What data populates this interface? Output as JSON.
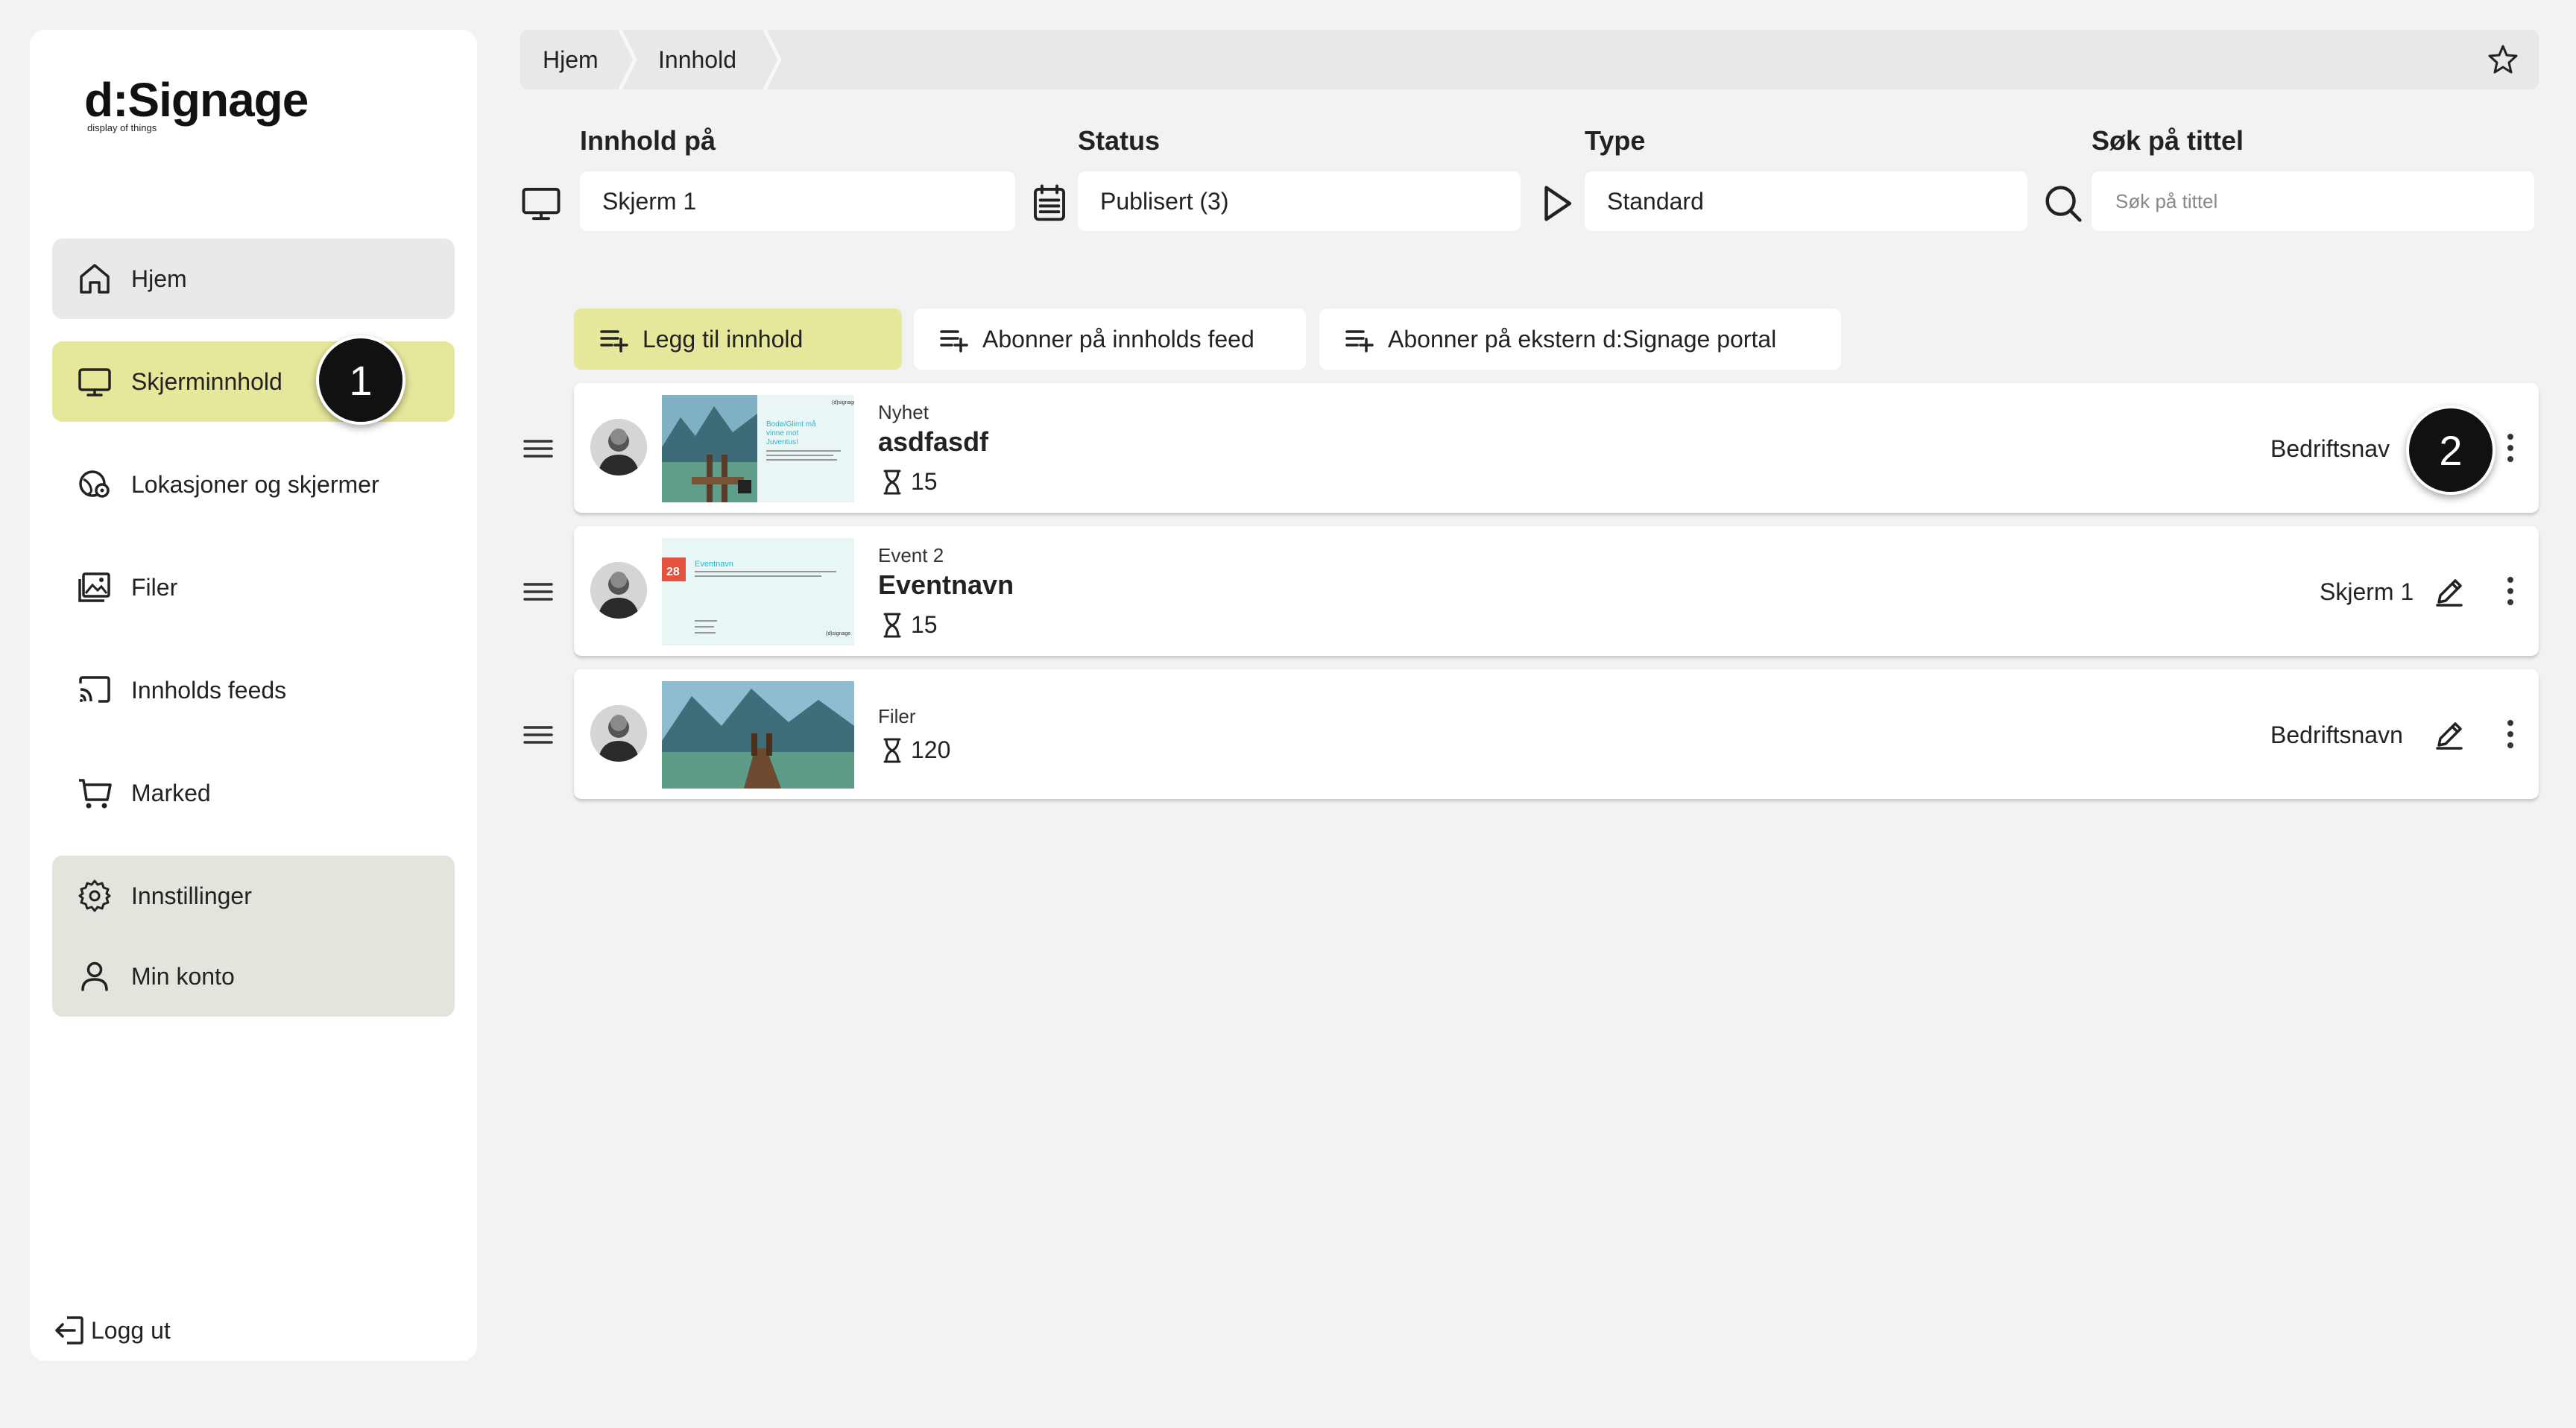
{
  "brand": {
    "name": "d:Signage",
    "tagline": "display of things"
  },
  "sidebar": {
    "items": [
      {
        "label": "Hjem",
        "icon": "home-icon"
      },
      {
        "label": "Skjerminnhold",
        "icon": "monitor-icon"
      },
      {
        "label": "Lokasjoner og skjermer",
        "icon": "location-icon"
      },
      {
        "label": "Filer",
        "icon": "image-icon"
      },
      {
        "label": "Innholds feeds",
        "icon": "cast-icon"
      },
      {
        "label": "Marked",
        "icon": "cart-icon"
      }
    ],
    "settings": [
      {
        "label": "Innstillinger",
        "icon": "gear-icon"
      },
      {
        "label": "Min konto",
        "icon": "user-icon"
      }
    ],
    "logout_label": "Logg ut",
    "active_color": "#e5e79b"
  },
  "breadcrumb": [
    "Hjem",
    "Innhold"
  ],
  "filters": {
    "content_on": {
      "label": "Innhold på",
      "value": "Skjerm 1"
    },
    "status": {
      "label": "Status",
      "value": "Publisert (3)"
    },
    "type": {
      "label": "Type",
      "value": "Standard"
    },
    "search": {
      "label": "Søk på tittel",
      "placeholder": "Søk på tittel",
      "value": ""
    }
  },
  "actions": {
    "add": "Legg til innhold",
    "subscribe_feed": "Abonner på innholds feed",
    "subscribe_portal": "Abonner på ekstern d:Signage portal"
  },
  "rows": [
    {
      "type": "Nyhet",
      "title": "asdfasdf",
      "duration": "15",
      "target": "Bedriftsnav",
      "thumb_text": "Bodø/Glimt må vinne mot Juventus!",
      "thumb_brand": "(d)signage"
    },
    {
      "type": "Event 2",
      "title": "Eventnavn",
      "duration": "15",
      "target": "Skjerm 1",
      "thumb_text": "Eventnavn",
      "thumb_date": "28",
      "thumb_brand": "(d)signage"
    },
    {
      "type": "Filer",
      "title": "",
      "duration": "120",
      "target": "Bedriftsnavn"
    }
  ],
  "steps": [
    "1",
    "2"
  ]
}
